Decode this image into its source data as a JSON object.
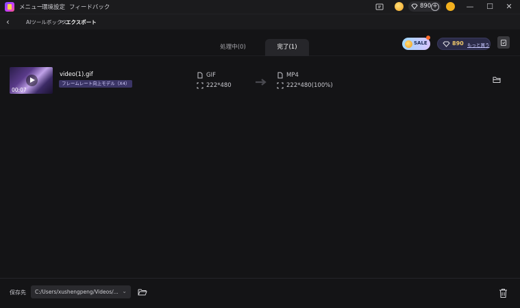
{
  "titlebar": {
    "menu_items": [
      "メニュー",
      "環境設定",
      "フィードバック"
    ],
    "gem_count": "890",
    "plus": "+"
  },
  "nav": {
    "breadcrumb": [
      "AIツールボックス",
      ">",
      "エクスポート"
    ]
  },
  "tabs": [
    {
      "label": "処理中(0)",
      "active": false
    },
    {
      "label": "完了(1)",
      "active": true
    }
  ],
  "promo": {
    "sale_label": "SALE",
    "gem_count": "890",
    "buy_label": "もっと買う"
  },
  "file": {
    "name": "video(1).gif",
    "duration": "00:07",
    "tag": "フレームレート向上モデル（X4）",
    "src_format": "GIF",
    "src_size": "222*480",
    "dst_format": "MP4",
    "dst_size": "222*480(100%)"
  },
  "bottom": {
    "save_label": "保存先",
    "path": "C:/Users/xushengpeng/Videos/..."
  },
  "colors": {
    "background": "#141416",
    "titlebar": "#1b1b1d",
    "active_tab": "#26262a",
    "tag_bg": "#3b3566",
    "gold": "#f0c86a"
  }
}
